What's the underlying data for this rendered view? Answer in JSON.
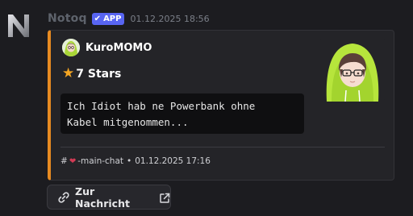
{
  "message": {
    "bot_name": "Notoq",
    "badge": "APP",
    "badge_check": "✔",
    "timestamp": "01.12.2025 18:56"
  },
  "embed": {
    "accent_color": "#e78a21",
    "author": "KuroMOMO",
    "title_icon": "star-icon",
    "title": "7 Stars",
    "quote": "Ich Idiot hab ne Powerbank ohne\nKabel mitgenommen...",
    "footer": {
      "hash": "#",
      "channel_icon": "heart-icon",
      "channel": "-main-chat",
      "separator": "•",
      "timestamp": "01.12.2025 17:16"
    }
  },
  "button": {
    "label": "Zur Nachricht",
    "icon": "link-icon",
    "trailing_icon": "external-link-icon"
  }
}
